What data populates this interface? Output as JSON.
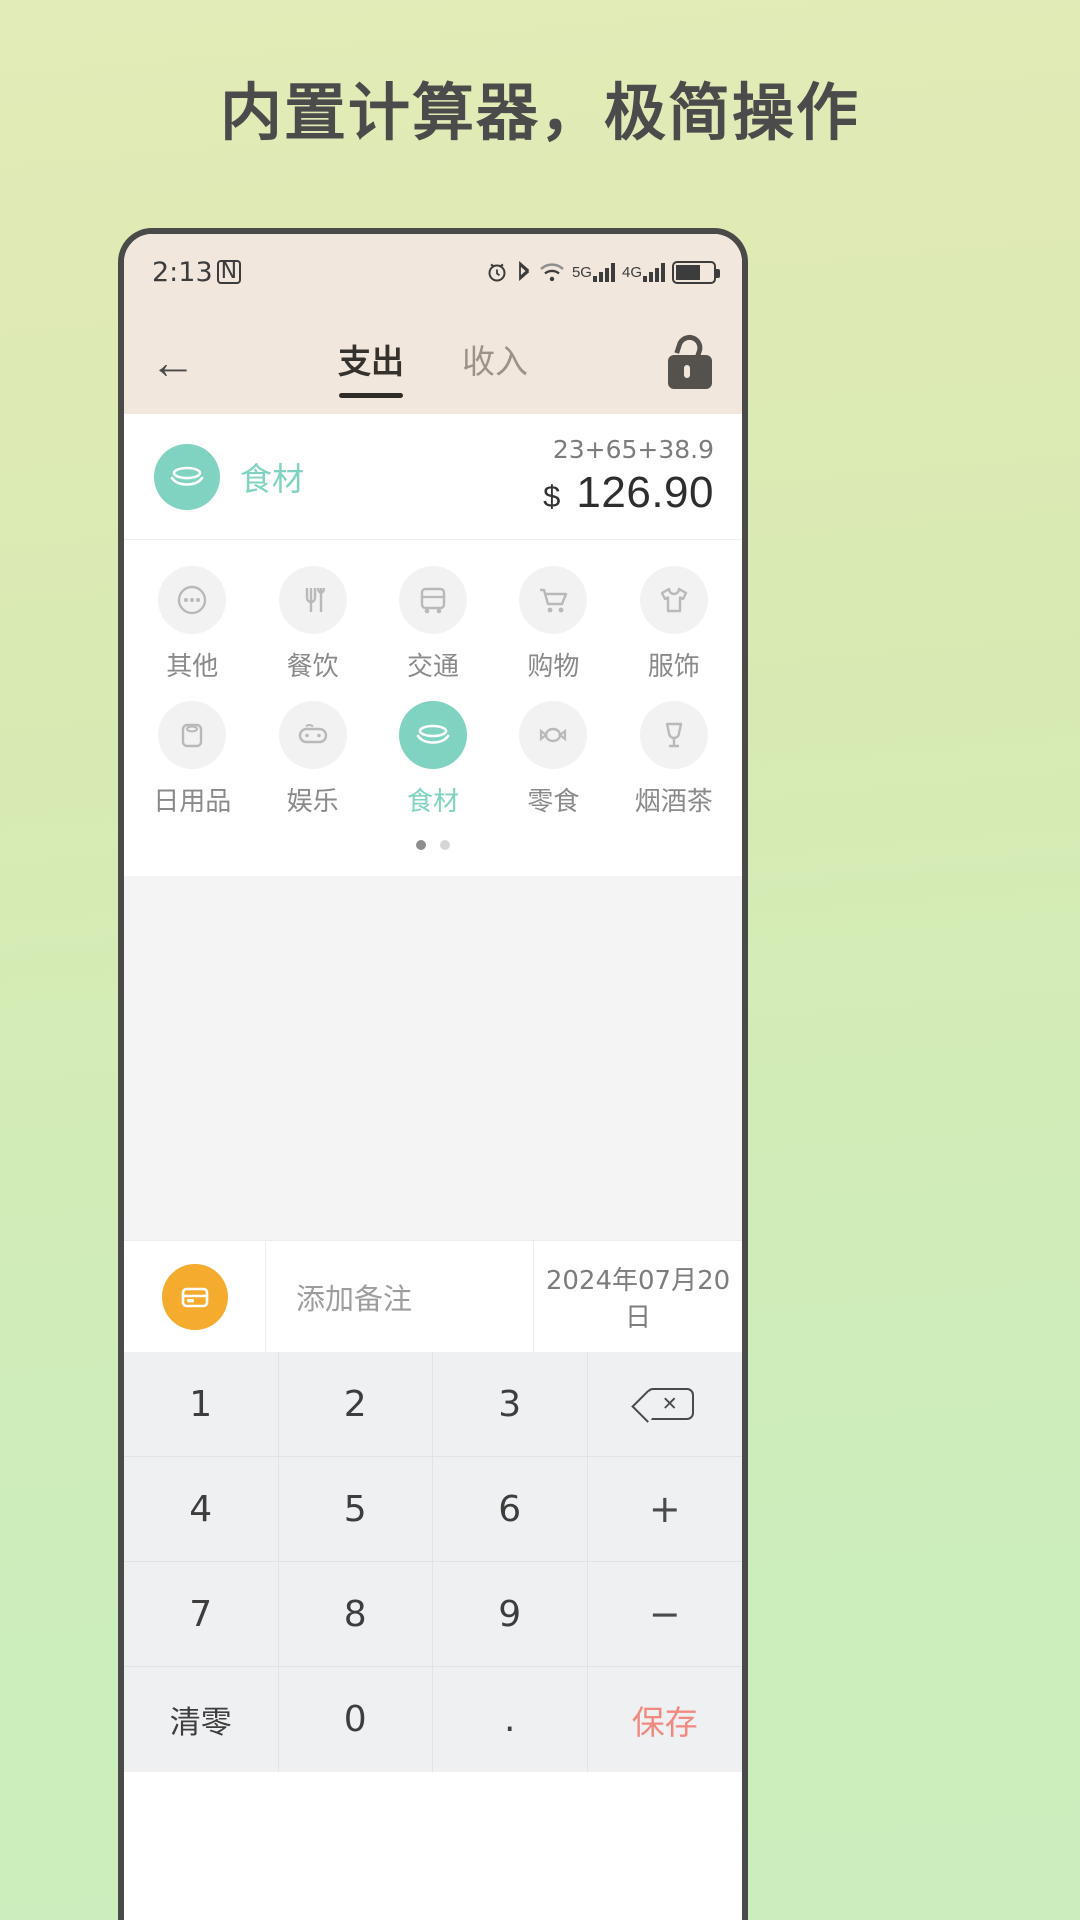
{
  "headline": "内置计算器，极简操作",
  "colors": {
    "accent_green": "#7fd3c0",
    "note_orange": "#f5ab2d",
    "save_red": "#f08a80",
    "header_bg": "#f2e7dd",
    "page_bg_top": "#e2ecb8",
    "page_bg_bottom": "#cbeebe"
  },
  "statusbar": {
    "time": "2:13",
    "nfc": "N",
    "icons": [
      "alarm-icon",
      "bluetooth-icon",
      "wifi-icon",
      "signal-5g-icon",
      "signal-4g-icon",
      "battery-charging-icon"
    ],
    "net_labels": [
      "5G",
      "4G"
    ]
  },
  "topnav": {
    "back": "←",
    "tabs": [
      {
        "label": "支出",
        "active": true
      },
      {
        "label": "收入",
        "active": false
      }
    ],
    "lock": "lock-open-icon"
  },
  "entry": {
    "category_label": "食材",
    "category_icon": "food-ingredient-icon",
    "expression": "23+65+38.9",
    "currency": "$",
    "amount": "126.90"
  },
  "categories": {
    "items": [
      {
        "label": "其他",
        "icon": "ellipsis-icon",
        "selected": false
      },
      {
        "label": "餐饮",
        "icon": "cutlery-icon",
        "selected": false
      },
      {
        "label": "交通",
        "icon": "bus-icon",
        "selected": false
      },
      {
        "label": "购物",
        "icon": "cart-icon",
        "selected": false
      },
      {
        "label": "服饰",
        "icon": "tshirt-icon",
        "selected": false
      },
      {
        "label": "日用品",
        "icon": "tissue-roll-icon",
        "selected": false
      },
      {
        "label": "娱乐",
        "icon": "gamepad-icon",
        "selected": false
      },
      {
        "label": "食材",
        "icon": "food-ingredient-icon",
        "selected": true
      },
      {
        "label": "零食",
        "icon": "candy-icon",
        "selected": false
      },
      {
        "label": "烟酒茶",
        "icon": "wine-glass-icon",
        "selected": false
      }
    ],
    "page_dots": [
      {
        "active": true
      },
      {
        "active": false
      }
    ]
  },
  "note": {
    "icon": "wallet-icon",
    "placeholder": "添加备注",
    "value": "",
    "date": "2024年07月20日"
  },
  "keypad": {
    "keys": [
      {
        "label": "1",
        "name": "key-1",
        "type": "num"
      },
      {
        "label": "2",
        "name": "key-2",
        "type": "num"
      },
      {
        "label": "3",
        "name": "key-3",
        "type": "num"
      },
      {
        "label": "⌫",
        "name": "key-backspace",
        "type": "backspace"
      },
      {
        "label": "4",
        "name": "key-4",
        "type": "num"
      },
      {
        "label": "5",
        "name": "key-5",
        "type": "num"
      },
      {
        "label": "6",
        "name": "key-6",
        "type": "num"
      },
      {
        "label": "+",
        "name": "key-plus",
        "type": "op"
      },
      {
        "label": "7",
        "name": "key-7",
        "type": "num"
      },
      {
        "label": "8",
        "name": "key-8",
        "type": "num"
      },
      {
        "label": "9",
        "name": "key-9",
        "type": "num"
      },
      {
        "label": "−",
        "name": "key-minus",
        "type": "op"
      },
      {
        "label": "清零",
        "name": "key-clear",
        "type": "clear"
      },
      {
        "label": "0",
        "name": "key-0",
        "type": "num"
      },
      {
        "label": ".",
        "name": "key-dot",
        "type": "num"
      },
      {
        "label": "保存",
        "name": "key-save",
        "type": "save"
      }
    ]
  }
}
